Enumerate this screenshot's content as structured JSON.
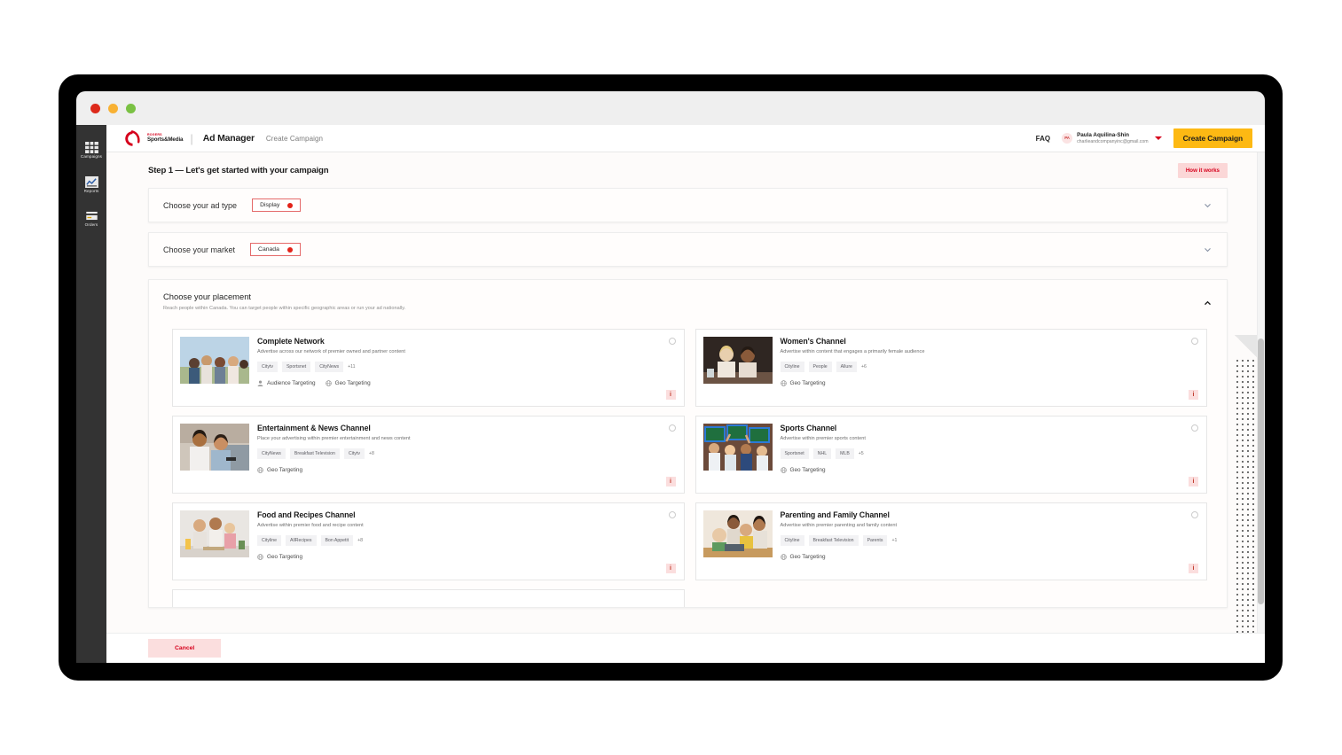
{
  "window": {
    "dots": [
      "close",
      "minimize",
      "zoom"
    ]
  },
  "rail": {
    "items": [
      {
        "label": "Campaigns",
        "icon": "grid-icon"
      },
      {
        "label": "Reports",
        "icon": "chart-icon"
      },
      {
        "label": "Orders",
        "icon": "card-icon"
      }
    ]
  },
  "header": {
    "brand_rogers": "ROGERS",
    "brand_sm": "Sports&Media",
    "divider": "|",
    "product": "Ad Manager",
    "breadcrumb": "Create Campaign",
    "faq": "FAQ",
    "account": {
      "initials": "PA",
      "name": "Paula Aquilina-Shin",
      "email": "charlieandcompanyinc@gmail.com"
    },
    "cta": "Create Campaign"
  },
  "step": {
    "title": "Step 1 — Let's get started with your campaign",
    "how_it_works": "How it works"
  },
  "selectors": [
    {
      "label": "Choose your ad type",
      "value": "Display",
      "chevron": "chevron-down-icon"
    },
    {
      "label": "Choose your market",
      "value": "Canada",
      "chevron": "chevron-down-icon"
    }
  ],
  "placement": {
    "title": "Choose your placement",
    "subtitle": "Reach people within Canada. You can target people within specific geographic areas or run your ad nationally.",
    "chevron": "chevron-up-icon",
    "info_label": "i",
    "cards": [
      {
        "title": "Complete Network",
        "desc": "Advertise across our network of premier owned and partner content",
        "tags": [
          "Citytv",
          "Sportsnet",
          "CityNews"
        ],
        "more": "+11",
        "features": [
          "Audience Targeting",
          "Geo Targeting"
        ],
        "thumb": "friends-outdoors-photo",
        "selected": false
      },
      {
        "title": "Women's Channel",
        "desc": "Advertise within content that engages a primarily female audience",
        "tags": [
          "Cityline",
          "People",
          "Allure"
        ],
        "more": "+6",
        "features": [
          "Geo Targeting"
        ],
        "thumb": "two-women-cafe-photo",
        "selected": false
      },
      {
        "title": "Entertainment & News Channel",
        "desc": "Place your advertising within premier entertainment and news content",
        "tags": [
          "CityNews",
          "Breakfast Television",
          "Citytv"
        ],
        "more": "+8",
        "features": [
          "Geo Targeting"
        ],
        "thumb": "couple-watching-tv-photo",
        "selected": false
      },
      {
        "title": "Sports Channel",
        "desc": "Advertise within premier sports content",
        "tags": [
          "Sportsnet",
          "NHL",
          "MLB"
        ],
        "more": "+5",
        "features": [
          "Geo Targeting"
        ],
        "thumb": "sports-fans-photo",
        "selected": false
      },
      {
        "title": "Food and Recipes Channel",
        "desc": "Advertise within premier food and recipe content",
        "tags": [
          "Cityline",
          "AllRecipes",
          "Bon Appetit"
        ],
        "more": "+8",
        "features": [
          "Geo Targeting"
        ],
        "thumb": "family-kitchen-photo",
        "selected": false
      },
      {
        "title": "Parenting and Family Channel",
        "desc": "Advertise within premier parenting and family content",
        "tags": [
          "Cityline",
          "Breakfast Television",
          "Parents"
        ],
        "more": "+1",
        "features": [
          "Geo Targeting"
        ],
        "thumb": "family-tablet-photo",
        "selected": false
      }
    ]
  },
  "footer": {
    "cancel": "Cancel"
  },
  "colors": {
    "brand_red": "#d6001c",
    "cta_yellow": "#fdb913",
    "rail_dark": "#333333",
    "pill_border": "#e46a6a"
  }
}
